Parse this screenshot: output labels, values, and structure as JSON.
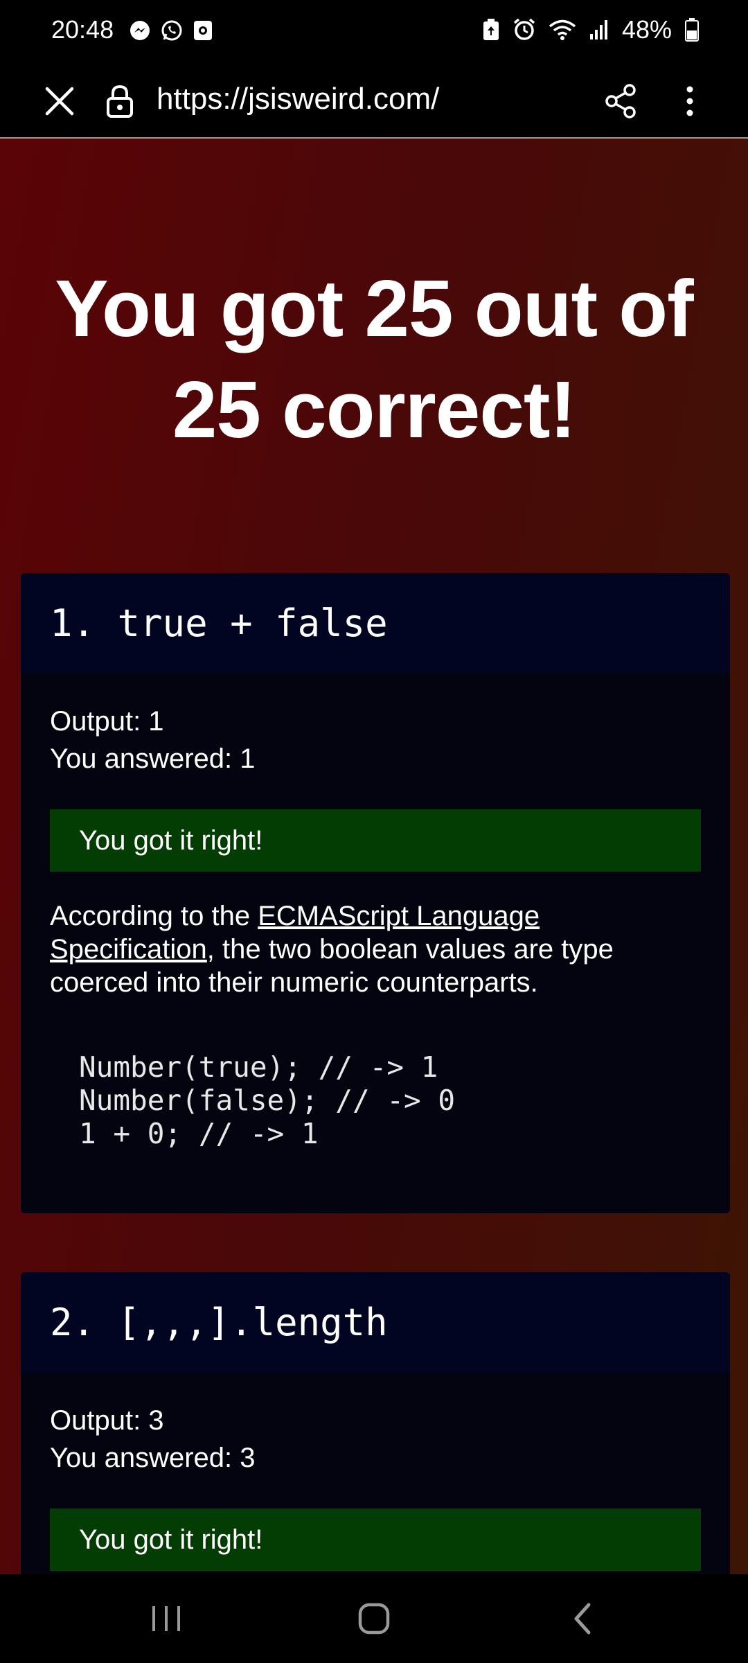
{
  "status_bar": {
    "time": "20:48",
    "battery": "48%",
    "left_icons": [
      "messenger-icon",
      "whatsapp-icon",
      "screen-recorder-icon"
    ],
    "right_icons": [
      "battery-saver-icon",
      "alarm-icon",
      "wifi-icon",
      "signal-icon",
      "battery-icon"
    ]
  },
  "browser": {
    "url": "https://jsisweird.com/"
  },
  "page": {
    "result_title": "You got 25 out of 25 correct!",
    "questions": [
      {
        "heading": "1. true + false",
        "output": "Output: 1",
        "answered": "You answered: 1",
        "verdict": "You got it right!",
        "explanation_prefix": "According to the ",
        "explanation_link": "ECMAScript Language Specification",
        "explanation_suffix": ", the two boolean values are type coerced into their numeric counterparts.",
        "code": "Number(true); // -> 1\nNumber(false); // -> 0\n1 + 0; // -> 1"
      },
      {
        "heading": "2. [,,,].length",
        "output": "Output: 3",
        "answered": "You answered: 3",
        "verdict": "You got it right!"
      }
    ]
  },
  "colors": {
    "verdict_bg": "#033d03",
    "card_head_bg": "#020521",
    "card_body_bg": "#03040f"
  }
}
